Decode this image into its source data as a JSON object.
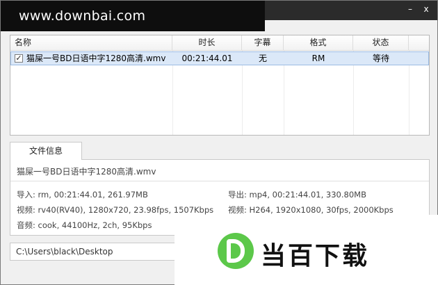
{
  "watermark": {
    "site_url": "www.downbai.com",
    "logo_text": "当百下载"
  },
  "window": {
    "minimize_glyph": "–",
    "close_glyph": "x"
  },
  "list": {
    "columns": [
      "名称",
      "时长",
      "字幕",
      "格式",
      "状态"
    ],
    "rows": [
      {
        "checked": true,
        "check_glyph": "✓",
        "name": "猫屎一号BD日语中字1280高清.wmv",
        "duration": "00:21:44.01",
        "subtitle": "无",
        "format": "RM",
        "status": "等待"
      }
    ]
  },
  "file_info": {
    "tab_label": "文件信息",
    "filename": "猫屎一号BD日语中字1280高清.wmv",
    "import": "导入: rm, 00:21:44.01, 261.97MB",
    "export": "导出: mp4, 00:21:44.01, 330.80MB",
    "video_in": "视频: rv40(RV40), 1280x720, 23.98fps, 1507Kbps",
    "video_out": "视频: H264, 1920x1080, 30fps, 2000Kbps",
    "audio_in": "音频: cook, 44100Hz, 2ch, 95Kbps"
  },
  "output_path": "C:\\Users\\black\\Desktop"
}
